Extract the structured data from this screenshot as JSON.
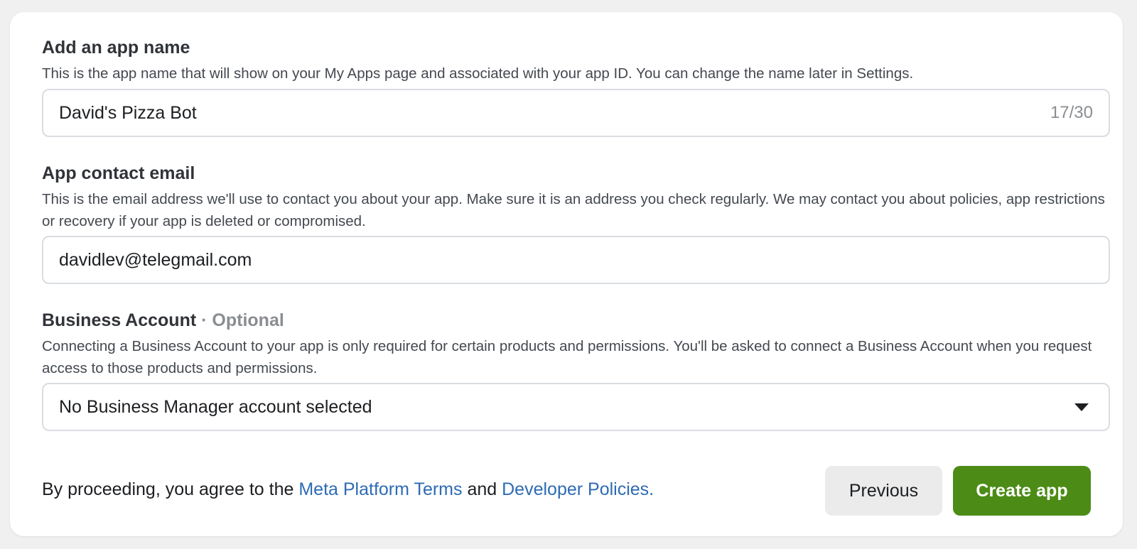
{
  "app_name": {
    "label": "Add an app name",
    "help": "This is the app name that will show on your My Apps page and associated with your app ID. You can change the name later in Settings.",
    "value": "David's Pizza Bot",
    "counter": "17/30"
  },
  "contact_email": {
    "label": "App contact email",
    "help": "This is the email address we'll use to contact you about your app. Make sure it is an address you check regularly. We may contact you about policies, app restrictions or recovery if your app is deleted or compromised.",
    "value": "davidlev@telegmail.com"
  },
  "business_account": {
    "label": "Business Account",
    "optional": "· Optional",
    "help": "Connecting a Business Account to your app is only required for certain products and permissions. You'll be asked to connect a Business Account when you request access to those products and permissions.",
    "selected": "No Business Manager account selected",
    "icon": "caret-down-icon"
  },
  "footer": {
    "prefix": "By proceeding, you agree to the ",
    "terms_link": "Meta Platform Terms",
    "conjunction": " and ",
    "policies_link": "Developer Policies."
  },
  "buttons": {
    "previous": "Previous",
    "create": "Create app"
  },
  "colors": {
    "link": "#2d6bb4",
    "primary_button": "#4c8c16",
    "secondary_button": "#ebebeb"
  }
}
